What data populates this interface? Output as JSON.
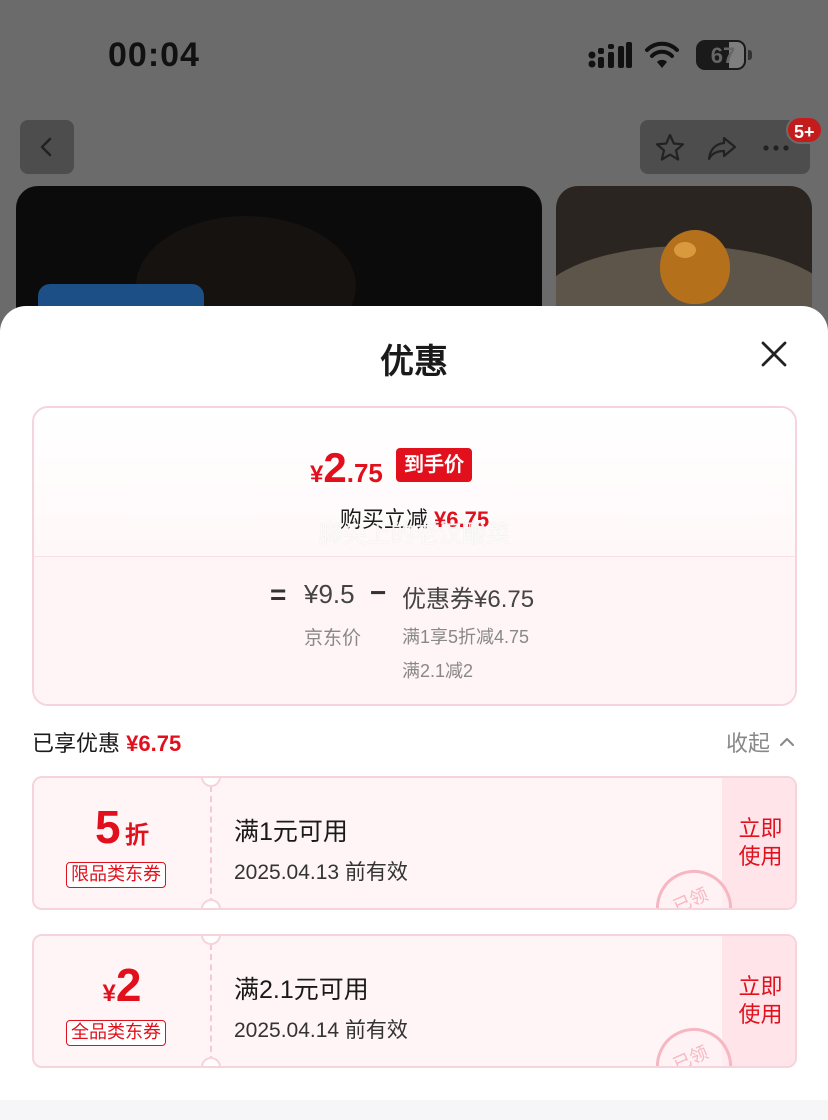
{
  "status_bar": {
    "time": "00:04",
    "battery_level": "67"
  },
  "header": {
    "badge_count": "5+"
  },
  "sheet": {
    "title": "优惠",
    "summary": {
      "final_price_currency": "¥",
      "final_price_int": "2",
      "final_price_dec": ".75",
      "final_price_tag": "到手价",
      "instant_discount_label": "购买立减",
      "instant_discount_amount": "¥6.75",
      "watermark": "脚尖上的老汉酸菜",
      "equals_sign": "=",
      "jd_price": "¥9.5",
      "jd_price_label": "京东价",
      "minus_sign": "−",
      "coupon_total": "优惠券¥6.75",
      "coupon_condition_1": "满1享5折减4.75",
      "coupon_condition_2": "满2.1减2"
    },
    "enjoyed_label": "已享优惠",
    "enjoyed_amount": "¥6.75",
    "collapse_label": "收起",
    "coupons": [
      {
        "value_main": "5",
        "value_unit": "折",
        "scope": "限品类东券",
        "condition": "满1元可用",
        "valid_until": "2025.04.13 前有效",
        "use_label": "立即使用",
        "stamp": "已领"
      },
      {
        "value_prefix": "¥",
        "value_main": "2",
        "scope": "全品类东券",
        "condition": "满2.1元可用",
        "valid_until": "2025.04.14 前有效",
        "use_label": "立即使用",
        "stamp": "已领"
      }
    ]
  },
  "colors": {
    "accent_red": "#e1101c",
    "coupon_bg": "#fff5f7",
    "border_pink": "#f6d4dc"
  }
}
